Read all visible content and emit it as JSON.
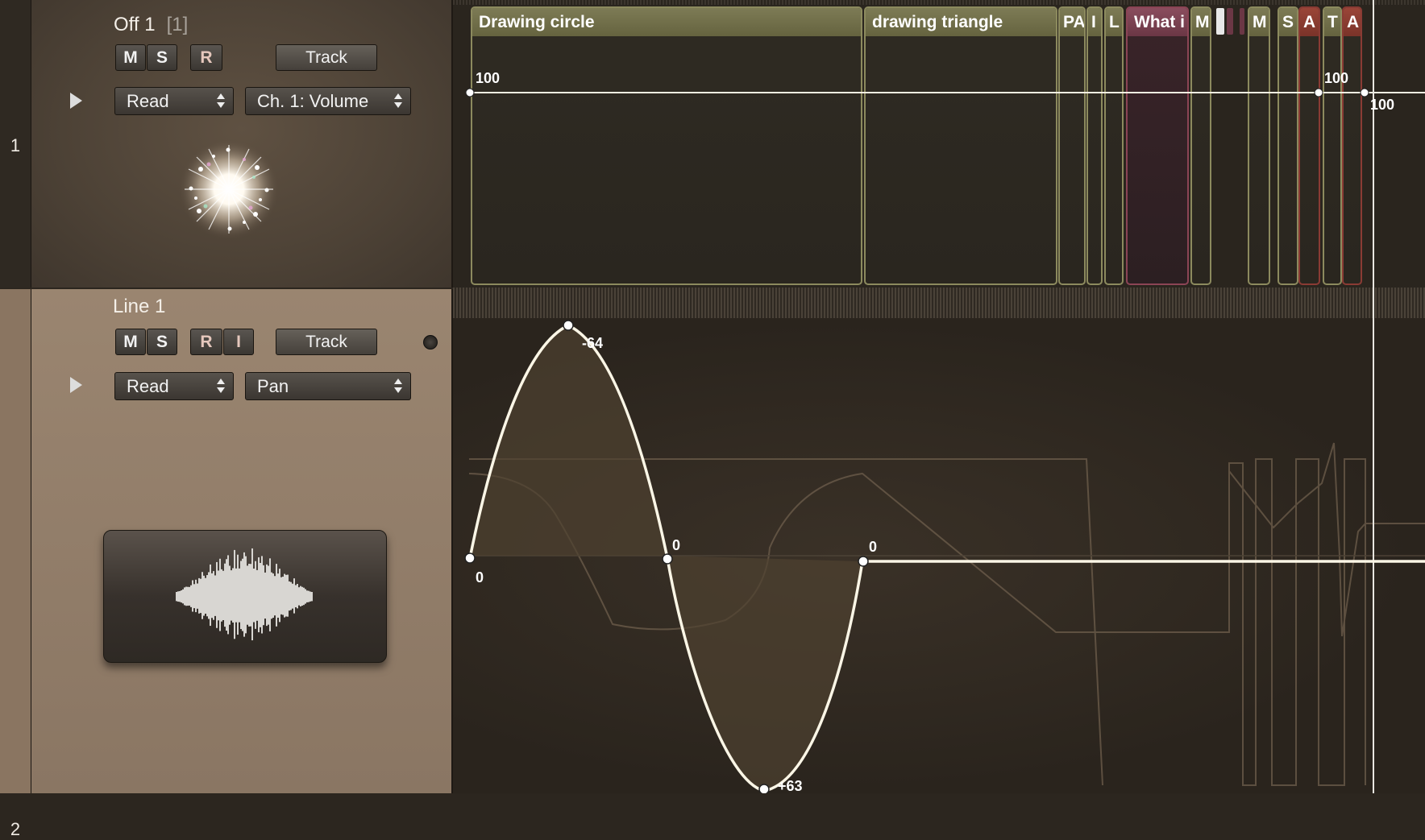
{
  "tracks": [
    {
      "number": "1",
      "title": "Off 1",
      "index_label": "[1]",
      "buttons": [
        "M",
        "S",
        "R"
      ],
      "track_button": "Track",
      "automation_mode": "Read",
      "automation_parameter": "Ch. 1: Volume",
      "icon": "sparkle-burst-icon"
    },
    {
      "number": "2",
      "title": "Line 1",
      "buttons": [
        "M",
        "S",
        "R",
        "I"
      ],
      "track_button": "Track",
      "automation_mode": "Read",
      "automation_parameter": "Pan",
      "icon": "waveform-icon"
    }
  ],
  "regions": [
    {
      "name": "Drawing circle"
    },
    {
      "name": "drawing triangle"
    },
    {
      "name": "PA"
    },
    {
      "name": "I"
    },
    {
      "name": "L"
    },
    {
      "name": "What i"
    },
    {
      "name": "M"
    },
    {
      "name": "M"
    },
    {
      "name": "S"
    },
    {
      "name": "A"
    },
    {
      "name": "T"
    },
    {
      "name": "A"
    }
  ],
  "volume_labels": {
    "start": "100",
    "mid": "100",
    "end": "100"
  },
  "pan_labels": {
    "p1": "0",
    "peak": "-64",
    "p2": "0",
    "trough": "+63",
    "p3": "0"
  },
  "colors": {
    "accent_region": "#7d7b55",
    "pink_region": "#8a4d5e",
    "red_region": "#9a4538",
    "curve": "#fbf6e6"
  }
}
